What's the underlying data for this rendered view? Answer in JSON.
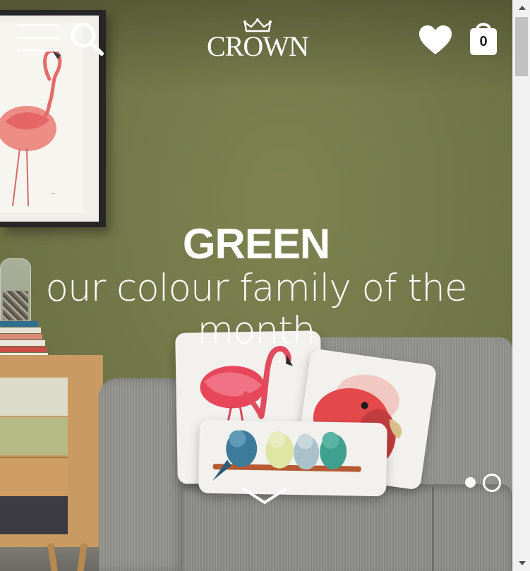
{
  "header": {
    "logo_text": "CROWN",
    "basket_count": "0"
  },
  "hero": {
    "title": "GREEN",
    "subtitle": "our colour family of the month"
  },
  "carousel": {
    "active_slide": 1,
    "slide_count": 2
  },
  "icons": {
    "menu": "hamburger-menu-icon",
    "search": "search-icon",
    "wishlist": "heart-icon",
    "basket": "shopping-bag-icon",
    "scroll": "chevron-down-icon"
  },
  "colors": {
    "wall_green": "#73784a",
    "header_icons": "#ffffff",
    "text": "#ffffff"
  }
}
